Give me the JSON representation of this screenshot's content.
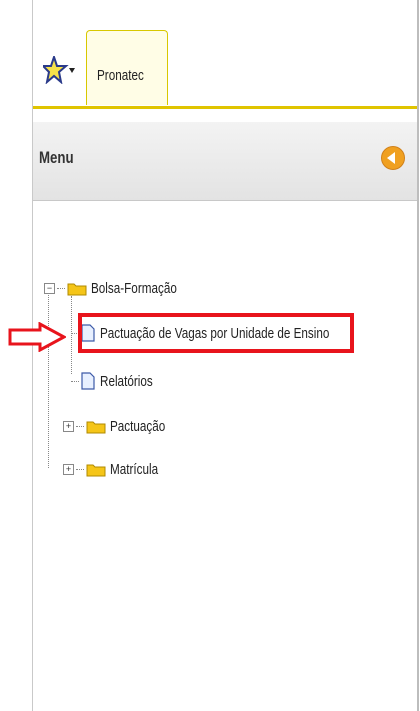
{
  "tabs": {
    "active_label": "Pronatec"
  },
  "menu": {
    "title": "Menu"
  },
  "tree": {
    "root": "Bolsa-Formação",
    "children": [
      "Pactuação de Vagas por Unidade de Ensino",
      "Relatórios"
    ],
    "siblings": [
      "Pactuação",
      "Matrícula"
    ]
  },
  "colors": {
    "highlight": "#e8141c",
    "accent": "#e0c400",
    "folder": "#f5c518"
  }
}
